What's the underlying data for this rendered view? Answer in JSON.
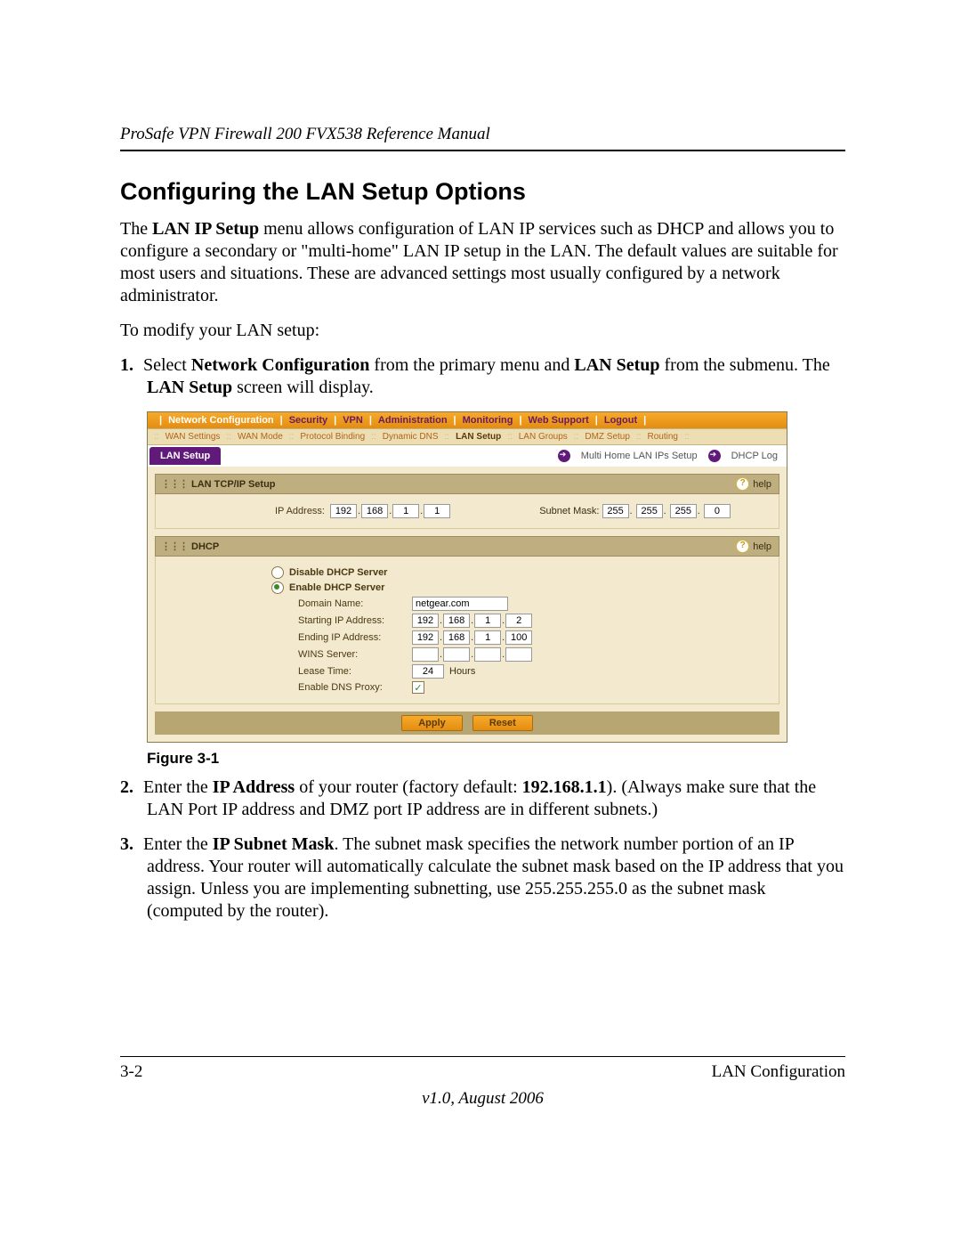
{
  "header_title": "ProSafe VPN Firewall 200 FVX538 Reference Manual",
  "section_title": "Configuring the LAN Setup Options",
  "intro_p1_a": "The ",
  "intro_p1_bold": "LAN IP Setup",
  "intro_p1_b": " menu allows configuration of LAN IP services such as DHCP and allows you to configure a secondary or \"multi-home\" LAN IP setup in the LAN. The default values are suitable for most users and situations. These are advanced settings most usually configured by a network administrator.",
  "intro_p2": "To modify your LAN setup:",
  "steps": {
    "s1_num": "1.",
    "s1_a": "Select ",
    "s1_b1": "Network Configuration",
    "s1_c": " from the primary menu and ",
    "s1_b2": "LAN Setup",
    "s1_d": " from the submenu. The ",
    "s1_b3": "LAN Setup",
    "s1_e": " screen will display.",
    "s2_num": "2.",
    "s2_a": "Enter the ",
    "s2_b1": "IP Address",
    "s2_c": " of your router (factory default: ",
    "s2_b2": "192.168.1.1",
    "s2_d": "). (Always make sure that the LAN Port IP address and DMZ port IP address are in different subnets.)",
    "s3_num": "3.",
    "s3_a": "Enter the ",
    "s3_b1": "IP Subnet Mask",
    "s3_c": ". The subnet mask specifies the network number portion of an IP address. Your router will automatically calculate the subnet mask based on the IP address that you assign. Unless you are implementing subnetting, use 255.255.255.0 as the subnet mask (computed by the router)."
  },
  "figure_caption": "Figure 3-1",
  "footer": {
    "page": "3-2",
    "chapter": "LAN Configuration",
    "version": "v1.0, August 2006"
  },
  "router": {
    "top_menu": [
      "Network Configuration",
      "Security",
      "VPN",
      "Administration",
      "Monitoring",
      "Web Support",
      "Logout"
    ],
    "sub_menu": [
      "WAN Settings",
      "WAN Mode",
      "Protocol Binding",
      "Dynamic DNS",
      "LAN Setup",
      "LAN Groups",
      "DMZ Setup",
      "Routing"
    ],
    "tab": "LAN Setup",
    "links": {
      "multi": "Multi Home LAN IPs Setup",
      "dhcplog": "DHCP Log"
    },
    "tcpip": {
      "title": "LAN TCP/IP Setup",
      "ip_label": "IP Address:",
      "ip": [
        "192",
        "168",
        "1",
        "1"
      ],
      "mask_label": "Subnet Mask:",
      "mask": [
        "255",
        "255",
        "255",
        "0"
      ]
    },
    "dhcp": {
      "title": "DHCP",
      "disable": "Disable DHCP Server",
      "enable": "Enable DHCP Server",
      "domain_label": "Domain Name:",
      "domain": "netgear.com",
      "start_label": "Starting IP Address:",
      "start": [
        "192",
        "168",
        "1",
        "2"
      ],
      "end_label": "Ending IP Address:",
      "end": [
        "192",
        "168",
        "1",
        "100"
      ],
      "wins_label": "WINS Server:",
      "wins": [
        "",
        "",
        "",
        ""
      ],
      "lease_label": "Lease Time:",
      "lease": "24",
      "lease_unit": "Hours",
      "proxy_label": "Enable DNS Proxy:"
    },
    "buttons": {
      "apply": "Apply",
      "reset": "Reset"
    },
    "help": "help"
  }
}
